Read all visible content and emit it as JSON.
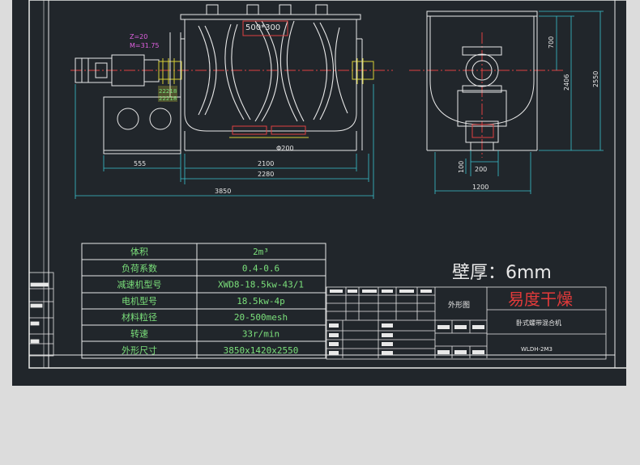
{
  "colors": {
    "background": "#dcdcdc",
    "canvas": "#21262b",
    "line_white": "#e8e8e8",
    "line_cyan": "#39c2cf",
    "line_yellow": "#d8cf35",
    "line_red": "#e04040",
    "text_green": "#7be07b",
    "text_magenta": "#e060e0",
    "title_red": "#e23a3a"
  },
  "drawing": {
    "front_view": {
      "gear_label_z": "Z=20",
      "gear_label_m": "M=31.75",
      "bearing_label_1": "22218",
      "bearing_label_2": "22218",
      "inlet_label": "500*300",
      "outlet_label": "Φ200"
    },
    "dimensions": {
      "front_555": "555",
      "front_2100": "2100",
      "front_2280": "2280",
      "front_3850": "3850",
      "side_700": "700",
      "side_2406": "2406",
      "side_2550": "2550",
      "side_100": "100",
      "side_200": "200",
      "side_1200": "1200"
    }
  },
  "spec_table": {
    "rows": [
      {
        "label": "体积",
        "value": "2m³"
      },
      {
        "label": "负荷系数",
        "value": "0.4-0.6"
      },
      {
        "label": "减速机型号",
        "value": "XWD8-18.5kw-43/1"
      },
      {
        "label": "电机型号",
        "value": "18.5kw-4p"
      },
      {
        "label": "材料粒径",
        "value": "20-500mesh"
      },
      {
        "label": "转速",
        "value": "33r/min"
      },
      {
        "label": "外形尺寸",
        "value": "3850x1420x2550"
      }
    ]
  },
  "wall_thickness": "壁厚：6mm",
  "title_block": {
    "view_name": "外形图",
    "company": "易度干燥",
    "product_name": "卧式螺带混合机",
    "model": "WLDH-2M3"
  }
}
